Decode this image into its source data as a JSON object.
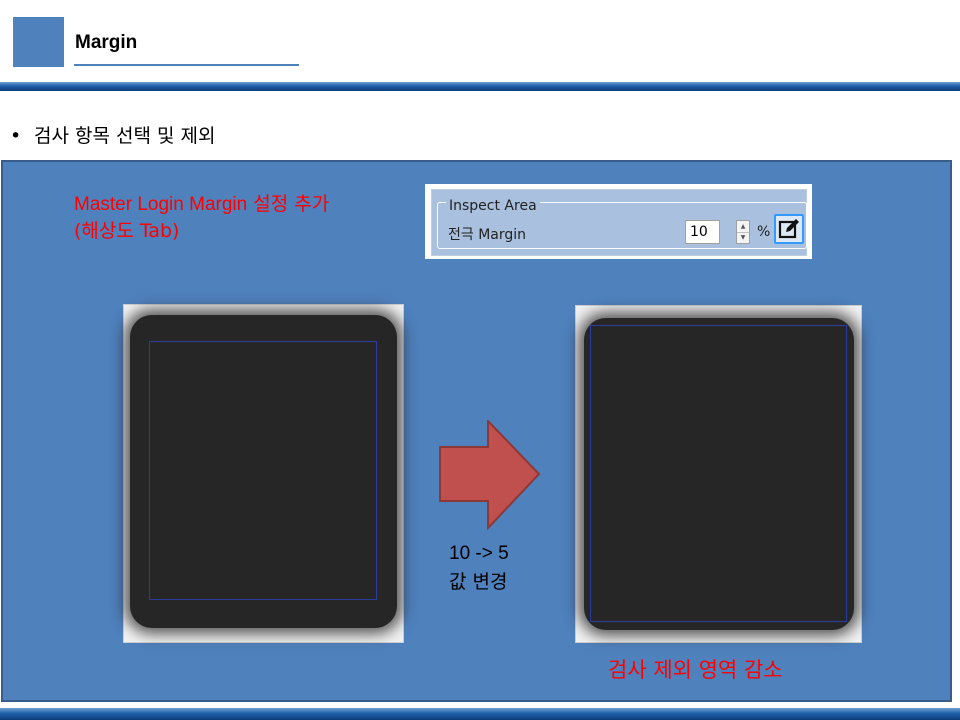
{
  "slide": {
    "title": "Margin",
    "bullet": "검사 항목 선택 및 제외"
  },
  "note": {
    "line1_en": "Master Login Margin",
    "line1_ko": " 설정 추가",
    "line2": "(해상도 Tab)"
  },
  "inspect_area": {
    "legend": "Inspect Area",
    "label": "전극 Margin",
    "value": "10",
    "unit": "%",
    "edit_icon": "edit-icon"
  },
  "change": {
    "line1": "10 -> 5",
    "line2": "값 변경"
  },
  "result_text": "검사 제외 영역 감소",
  "colors": {
    "accent": "#4f81bd",
    "panel": "#4f81bd",
    "arrow": "#c0504d",
    "note": "#ff0000",
    "roi": "#2a3c9e"
  }
}
